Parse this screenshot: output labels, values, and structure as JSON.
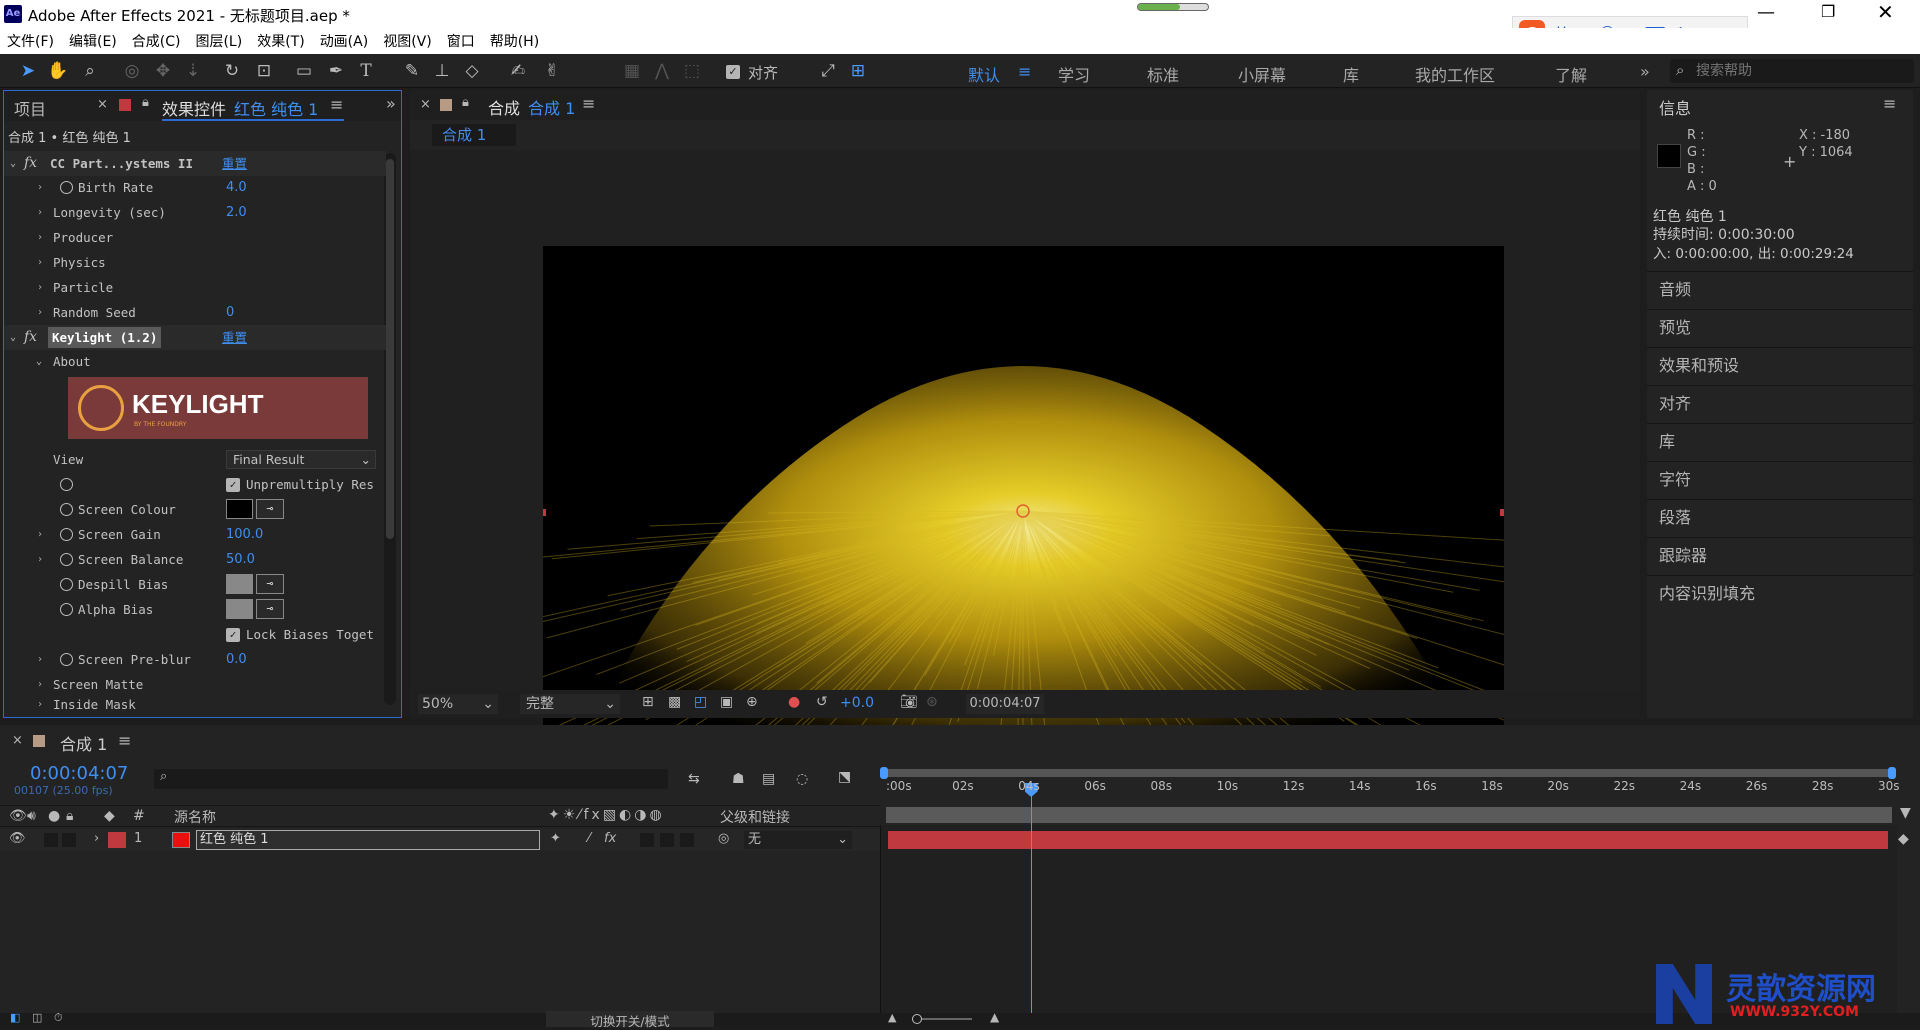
{
  "window": {
    "title": "Adobe After Effects 2021 - 无标题项目.aep *",
    "app_icon": "Ae"
  },
  "ime": {
    "lang": "英",
    "punct": "•,",
    "items": [
      "emoji-icon",
      "mic-icon",
      "keyboard-icon",
      "skin-icon",
      "shirt-icon",
      "grid-icon"
    ]
  },
  "menu": [
    "文件(F)",
    "编辑(E)",
    "合成(C)",
    "图层(L)",
    "效果(T)",
    "动画(A)",
    "视图(V)",
    "窗口",
    "帮助(H)"
  ],
  "toolbar": {
    "align_label": "对齐",
    "workspaces": [
      "默认",
      "学习",
      "标准",
      "小屏幕",
      "库",
      "我的工作区",
      "了解"
    ],
    "search_placeholder": "搜索帮助"
  },
  "left_panel": {
    "tab_project": "项目",
    "tab_effects": "效果控件",
    "layer_name": "红色 纯色 1",
    "breadcrumb": "合成 1 • 红色 纯色 1",
    "fx1": {
      "name": "CC Part...ystems II",
      "reset": "重置",
      "props": [
        {
          "label": "Birth Rate",
          "value": "4.0"
        },
        {
          "label": "Longevity (sec)",
          "value": "2.0"
        },
        {
          "label": "Producer",
          "value": ""
        },
        {
          "label": "Physics",
          "value": ""
        },
        {
          "label": "Particle",
          "value": ""
        },
        {
          "label": "Random Seed",
          "value": "0"
        }
      ]
    },
    "fx2": {
      "name": "Keylight (1.2)",
      "reset": "重置",
      "about": "About",
      "logo_text": "KEYLIGHT",
      "logo_sub": "BY THE FOUNDRY",
      "view_label": "View",
      "view_value": "Final Result",
      "unpremultiply": "Unpremultiply Res",
      "screen_colour": "Screen Colour",
      "screen_gain": "Screen Gain",
      "screen_gain_val": "100.0",
      "screen_balance": "Screen Balance",
      "screen_balance_val": "50.0",
      "despill": "Despill Bias",
      "alpha": "Alpha Bias",
      "lock": "Lock Biases Toget",
      "preblur": "Screen Pre-blur",
      "preblur_val": "0.0",
      "matte": "Screen Matte",
      "inside": "Inside Mask"
    }
  },
  "comp_panel": {
    "tab_label": "合成",
    "comp_name": "合成 1",
    "sub_tab": "合成 1",
    "zoom": "50%",
    "quality": "完整",
    "exposure": "+0.0",
    "timecode": "0:00:04:07"
  },
  "info_panel": {
    "title": "信息",
    "r": "R :",
    "g": "G :",
    "b": "B :",
    "a": "A : 0",
    "x": "X : -180",
    "y": "Y : 1064",
    "layer": "红色 纯色 1",
    "duration": "持续时间: 0:00:30:00",
    "inout": "入: 0:00:00:00, 出: 0:00:29:24",
    "sections": [
      "音频",
      "预览",
      "效果和预设",
      "对齐",
      "库",
      "字符",
      "段落",
      "跟踪器",
      "内容识别填充"
    ]
  },
  "timeline": {
    "comp_name": "合成 1",
    "timecode": "0:00:04:07",
    "frames": "00107 (25.00 fps)",
    "col_hash": "#",
    "col_source": "源名称",
    "col_parent": "父级和链接",
    "layer_num": "1",
    "layer_name": "红色 纯色 1",
    "parent_value": "无",
    "toggle_label": "切换开关/模式",
    "ticks": [
      ":00s",
      "02s",
      "04s",
      "06s",
      "08s",
      "10s",
      "12s",
      "14s",
      "16s",
      "18s",
      "20s",
      "22s",
      "24s",
      "26s",
      "28s",
      "30s"
    ],
    "playhead_seconds": 4.28
  },
  "watermark": {
    "text": "灵歆资源网",
    "url": "WWW.932Y.COM"
  },
  "colors": {
    "accent": "#3f8ef0",
    "layer_red": "#c0393f",
    "solid_red": "#e81010"
  }
}
